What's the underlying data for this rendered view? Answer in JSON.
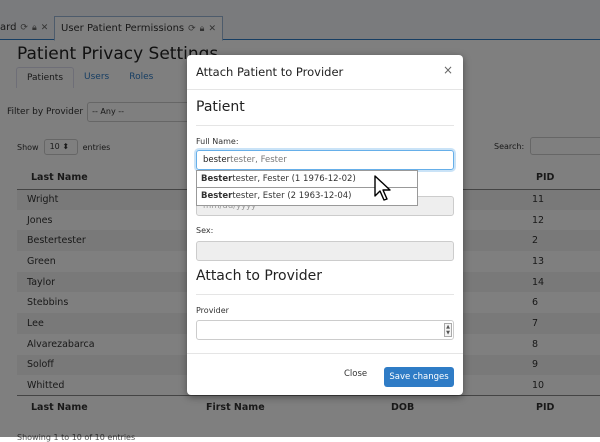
{
  "tabs": [
    {
      "label": "ard",
      "icons": [
        "refresh",
        "lock",
        "close"
      ]
    },
    {
      "label": "User Patient Permissions",
      "icons": [
        "refresh",
        "lock",
        "close"
      ]
    }
  ],
  "page": {
    "title": "Patient Privacy Settings",
    "subtabs": [
      "Patients",
      "Users",
      "Roles"
    ],
    "filter": {
      "label": "Filter by Provider",
      "value": "-- Any --"
    },
    "show": {
      "prefix": "Show",
      "value": "10",
      "suffix": "entries"
    },
    "search_label": "Search:",
    "columns": [
      "Last Name",
      "First Name",
      "DOB",
      "PID"
    ],
    "rows": [
      {
        "last": "Wright",
        "pid": "11"
      },
      {
        "last": "Jones",
        "pid": "12"
      },
      {
        "last": "Bestertester",
        "pid": "2"
      },
      {
        "last": "Green",
        "pid": "13"
      },
      {
        "last": "Taylor",
        "pid": "14"
      },
      {
        "last": "Stebbins",
        "pid": "6"
      },
      {
        "last": "Lee",
        "pid": "7"
      },
      {
        "last": "Alvarezabarca",
        "pid": "8"
      },
      {
        "last": "Soloff",
        "pid": "9"
      },
      {
        "last": "Whitted",
        "pid": "10"
      }
    ],
    "info": "Showing 1 to 10 of 10 entries"
  },
  "modal": {
    "title": "Attach Patient to Provider",
    "close_glyph": "×",
    "patient_section": "Patient",
    "full_name_label": "Full Name:",
    "full_name_typed": "bester",
    "full_name_ghost": "tester, Fester",
    "suggestions": [
      {
        "bold": "Bester",
        "rest": "tester, Fester (1 1976-12-02)"
      },
      {
        "bold": "Bester",
        "rest": "tester, Ester (2 1963-12-04)"
      }
    ],
    "dob_placeholder": "mm/dd/yyyy",
    "sex_label": "Sex:",
    "provider_section": "Attach to Provider",
    "provider_label": "Provider",
    "close_button": "Close",
    "save_button": "Save changes"
  }
}
